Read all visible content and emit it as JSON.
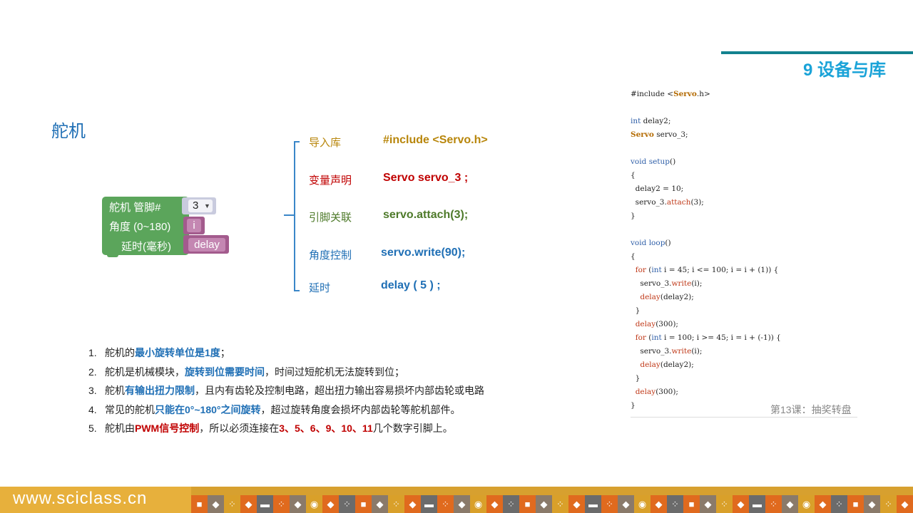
{
  "chapter": "9 设备与库",
  "slide_title": "舵机",
  "block": {
    "label_pin": "舵机  管脚#",
    "pin_value": "3",
    "label_angle": "角度 (0~180)",
    "angle_var": "i",
    "label_delay": "延时(毫秒)",
    "delay_var": "delay"
  },
  "mapping": [
    {
      "label": "导入库",
      "code": "#include <Servo.h>",
      "color": "#b8860b"
    },
    {
      "label": "变量声明",
      "code": "Servo servo_3 ;",
      "color": "#c00000"
    },
    {
      "label": "引脚关联",
      "code": "servo.attach(3);",
      "color": "#4e7a2a"
    },
    {
      "label": "角度控制",
      "code": "servo.write(90);",
      "color": "#1f6fb5"
    },
    {
      "label": "延时",
      "code": "delay ( 5 ) ;",
      "color": "#1f6fb5"
    }
  ],
  "notes": [
    {
      "num": "1.",
      "parts": [
        [
          "舵机的",
          ""
        ],
        [
          "最小旋转单位是1度",
          "hb"
        ],
        [
          "；",
          ""
        ]
      ]
    },
    {
      "num": "2.",
      "parts": [
        [
          "舵机是机械模块，",
          ""
        ],
        [
          "旋转到位需要时间",
          "hb"
        ],
        [
          "，时间过短舵机无法旋转到位；",
          ""
        ]
      ]
    },
    {
      "num": "3.",
      "parts": [
        [
          "舵机",
          ""
        ],
        [
          "有输出扭力限制",
          "hb"
        ],
        [
          "，且内有齿轮及控制电路，超出扭力输出容易损坏内部齿轮或电路",
          ""
        ]
      ]
    },
    {
      "num": "4.",
      "parts": [
        [
          "常见的舵机",
          ""
        ],
        [
          "只能在0°~180°之间旋转",
          "hb"
        ],
        [
          "，超过旋转角度会损坏内部齿轮等舵机部件。",
          ""
        ]
      ]
    },
    {
      "num": "5.",
      "parts": [
        [
          "舵机由",
          ""
        ],
        [
          "PWM信号控制",
          "hr"
        ],
        [
          "，所以必须连接在",
          ""
        ],
        [
          "3、5、6、9、10、11",
          "hr"
        ],
        [
          "几个数字引脚上。",
          ""
        ]
      ]
    }
  ],
  "listing": [
    [
      [
        "#include <",
        ""
      ],
      [
        "Servo",
        "ty"
      ],
      [
        ".h>",
        ""
      ]
    ],
    [],
    [
      [
        "int",
        "kw"
      ],
      [
        " delay2;",
        ""
      ]
    ],
    [
      [
        "Servo",
        "ty"
      ],
      [
        " servo_3;",
        ""
      ]
    ],
    [],
    [
      [
        "void",
        "kw"
      ],
      [
        " ",
        ""
      ],
      [
        "setup",
        "kw"
      ],
      [
        "()",
        ""
      ]
    ],
    [
      [
        "{",
        ""
      ]
    ],
    [
      [
        "  delay2 = 10;",
        ""
      ]
    ],
    [
      [
        "  servo_3.",
        ""
      ],
      [
        "attach",
        "fn"
      ],
      [
        "(3);",
        ""
      ]
    ],
    [
      [
        "}",
        ""
      ]
    ],
    [],
    [
      [
        "void",
        "kw"
      ],
      [
        " ",
        ""
      ],
      [
        "loop",
        "kw"
      ],
      [
        "()",
        ""
      ]
    ],
    [
      [
        "{",
        ""
      ]
    ],
    [
      [
        "  ",
        ""
      ],
      [
        "for",
        "fn"
      ],
      [
        " (",
        ""
      ],
      [
        "int",
        "kw"
      ],
      [
        " i = 45; i <= 100; i = i + (1)) {",
        ""
      ]
    ],
    [
      [
        "    servo_3.",
        ""
      ],
      [
        "write",
        "fn"
      ],
      [
        "(i);",
        ""
      ]
    ],
    [
      [
        "    ",
        ""
      ],
      [
        "delay",
        "fn"
      ],
      [
        "(delay2);",
        ""
      ]
    ],
    [
      [
        "  }",
        ""
      ]
    ],
    [
      [
        "  ",
        ""
      ],
      [
        "delay",
        "fn"
      ],
      [
        "(300);",
        ""
      ]
    ],
    [
      [
        "  ",
        ""
      ],
      [
        "for",
        "fn"
      ],
      [
        " (",
        ""
      ],
      [
        "int",
        "kw"
      ],
      [
        " i = 100; i >= 45; i = i + (-1)) {",
        ""
      ]
    ],
    [
      [
        "    servo_3.",
        ""
      ],
      [
        "write",
        "fn"
      ],
      [
        "(i);",
        ""
      ]
    ],
    [
      [
        "    ",
        ""
      ],
      [
        "delay",
        "fn"
      ],
      [
        "(delay2);",
        ""
      ]
    ],
    [
      [
        "  }",
        ""
      ]
    ],
    [
      [
        "  ",
        ""
      ],
      [
        "delay",
        "fn"
      ],
      [
        "(300);",
        ""
      ]
    ],
    [
      [
        "}",
        ""
      ]
    ]
  ],
  "lesson_caption": "第13课：抽奖转盘",
  "footer": {
    "site": "www.sciclass.cn",
    "tile_colors": [
      "#e06a1e",
      "#8a7a6a",
      "#d9a02a",
      "#e06a1e",
      "#6b6b6b"
    ],
    "tile_glyphs": [
      "■",
      "◆",
      "⁘",
      "◆",
      "▬",
      "⁘",
      "◆",
      "◉",
      "◆",
      "⁘"
    ]
  }
}
